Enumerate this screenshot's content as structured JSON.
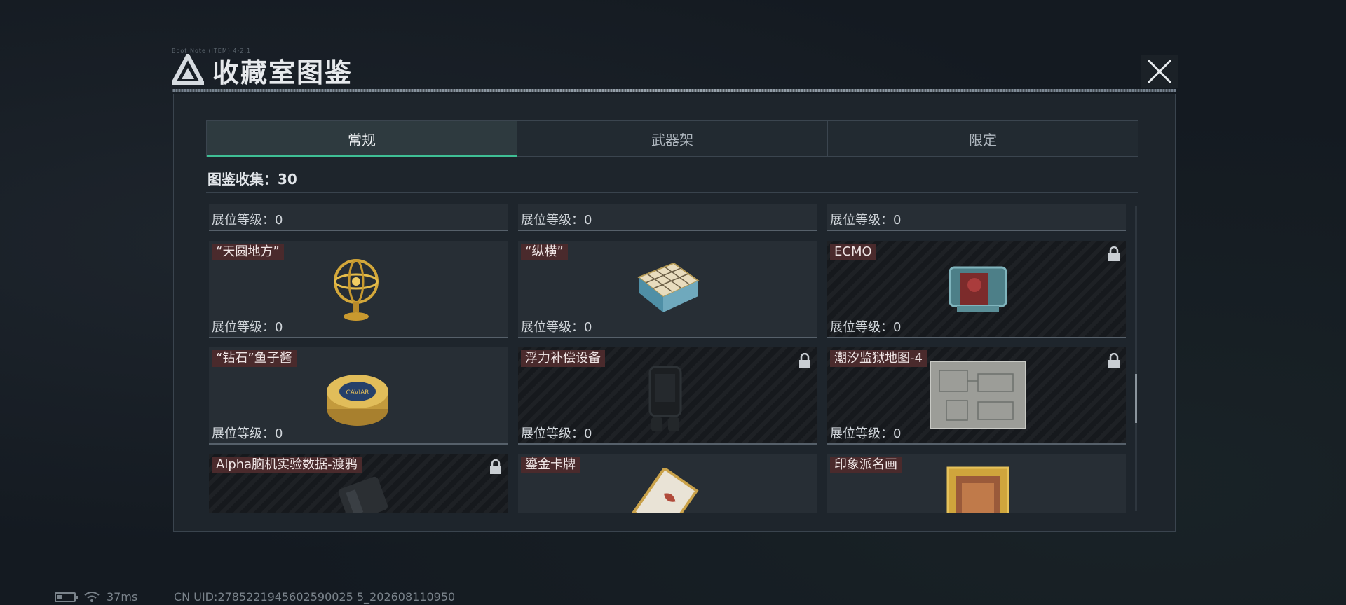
{
  "window": {
    "title": "收藏室图鉴",
    "tiny_caption": "Boot Note (ITEM) 4-2.1"
  },
  "tabs": [
    {
      "label": "常规",
      "active": true
    },
    {
      "label": "武器架",
      "active": false
    },
    {
      "label": "限定",
      "active": false
    }
  ],
  "collection": {
    "label": "图鉴收集：30"
  },
  "cards": [
    {
      "name": "",
      "level": "展位等级：0",
      "locked": false
    },
    {
      "name": "",
      "level": "展位等级：0",
      "locked": false
    },
    {
      "name": "",
      "level": "展位等级：0",
      "locked": false
    },
    {
      "name": "“天圆地方”",
      "level": "展位等级：0",
      "locked": false,
      "icon": "armillary-sphere-icon"
    },
    {
      "name": "“纵横”",
      "level": "展位等级：0",
      "locked": false,
      "icon": "chess-box-icon"
    },
    {
      "name": "ECMO",
      "level": "展位等级：0",
      "locked": true,
      "icon": "ecmo-machine-icon"
    },
    {
      "name": "“钻石”鱼子酱",
      "level": "展位等级：0",
      "locked": false,
      "icon": "caviar-tin-icon"
    },
    {
      "name": "浮力补偿设备",
      "level": "展位等级：0",
      "locked": true,
      "icon": "bcd-vest-icon"
    },
    {
      "name": "潮汐监狱地图-4",
      "level": "展位等级：0",
      "locked": true,
      "icon": "prison-map-icon"
    },
    {
      "name": "Alpha脑机实验数据-渡鸦",
      "level": "",
      "locked": true,
      "icon": "data-device-icon"
    },
    {
      "name": "鎏金卡牌",
      "level": "",
      "locked": false,
      "icon": "gilded-card-icon"
    },
    {
      "name": "印象派名画",
      "level": "",
      "locked": false,
      "icon": "framed-painting-icon"
    }
  ],
  "status": {
    "ping": "37ms",
    "uid": "CN UID:2785221945602590025 5_202608110950"
  }
}
